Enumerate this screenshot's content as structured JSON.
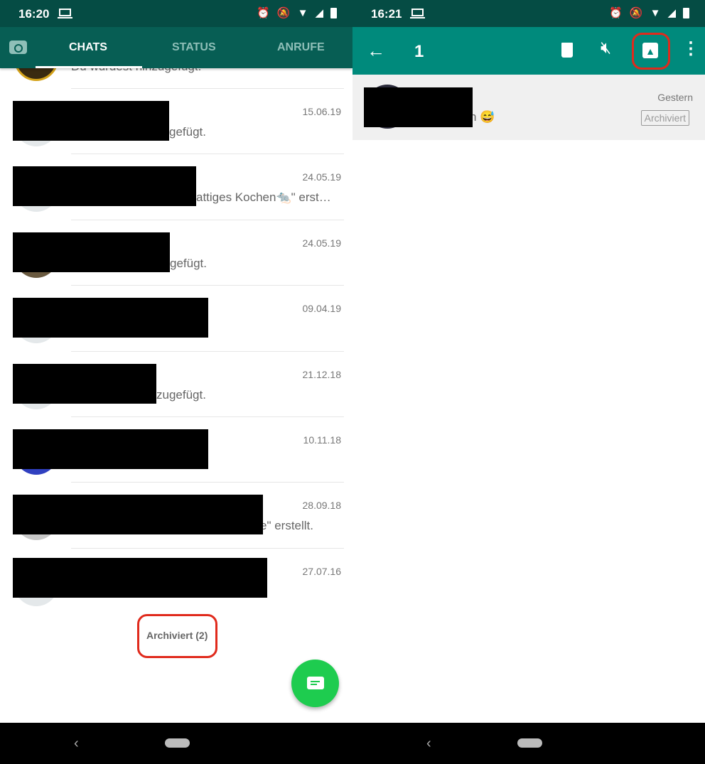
{
  "left": {
    "status": {
      "time": "16:20"
    },
    "tabs": [
      {
        "label": "CHATS"
      },
      {
        "label": "STATUS"
      },
      {
        "label": "ANRUFE"
      }
    ],
    "top_partial_snippet": "Du wurdest hinzugefügt.",
    "chats": [
      {
        "date": "15.06.19",
        "snippet": "gefügt."
      },
      {
        "date": "24.05.19",
        "snippet": "attiges Kochen🐀\" erst…"
      },
      {
        "date": "24.05.19",
        "snippet": "gefügt."
      },
      {
        "date": "09.04.19",
        "snippet": ""
      },
      {
        "date": "21.12.18",
        "snippet": "zugefügt."
      },
      {
        "date": "10.11.18",
        "snippet": ""
      },
      {
        "date": "28.09.18",
        "snippet": "e\" erstellt."
      },
      {
        "date": "27.07.16",
        "snippet": ""
      }
    ],
    "archived_link": "Archiviert (2)"
  },
  "right": {
    "status": {
      "time": "16:21"
    },
    "selected_count": "1",
    "row": {
      "date": "Gestern",
      "snippet": "n 😅",
      "badge": "Archiviert"
    }
  },
  "colors": {
    "header": "#075e54",
    "status_bar": "#054c44",
    "selection_toolbar": "#008a7c",
    "fab": "#1ecc4f",
    "highlight": "#e02a1c"
  }
}
